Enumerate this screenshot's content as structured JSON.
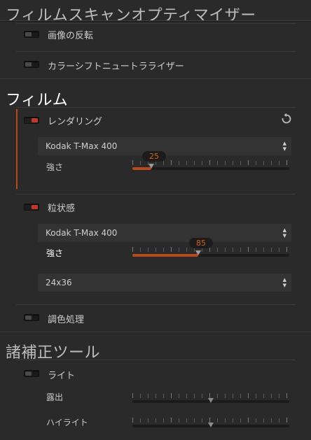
{
  "optimizer": {
    "title": "フィルムスキャンオプティマイザー",
    "invert_label": "画像の反転",
    "color_shift_label": "カラーシフトニュートラライザー"
  },
  "film": {
    "title": "フィルム",
    "rendering": {
      "label": "レンダリング",
      "enabled": true,
      "film_select": "Kodak T-Max 400",
      "strength_label": "強さ",
      "strength_value": "25",
      "strength_fraction": 0.12
    },
    "grain": {
      "label": "粒状感",
      "enabled": true,
      "film_select": "Kodak T-Max 400",
      "strength_label": "強さ",
      "strength_value": "85",
      "strength_fraction": 0.42,
      "size_select": "24x36"
    },
    "toning_label": "調色処理"
  },
  "tools": {
    "title": "諸補正ツール",
    "light": {
      "label": "ライト",
      "exposure_label": "露出",
      "exposure_fraction": 0.5,
      "highlight_label": "ハイライト",
      "highlight_fraction": 0.5
    }
  },
  "icons": {
    "reset": "reset-icon",
    "select_arrows": "updown-arrows-icon"
  },
  "colors": {
    "accent": "#b8491a",
    "toggle_on": "#c0392b",
    "value_text": "#d0621f"
  }
}
